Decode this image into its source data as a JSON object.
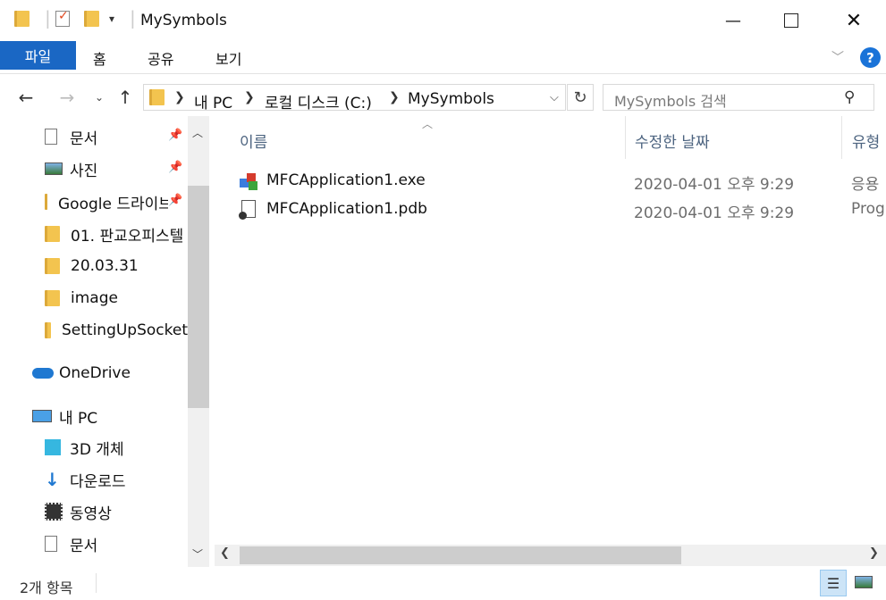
{
  "window": {
    "title": "MySymbols"
  },
  "ribbon": {
    "tabs": [
      "파일",
      "홈",
      "공유",
      "보기"
    ]
  },
  "address": {
    "crumbs": [
      "내 PC",
      "로컬 디스크 (C:)",
      "MySymbols"
    ]
  },
  "search": {
    "placeholder": "MySymbols 검색"
  },
  "sidebar": {
    "quick_access": [
      {
        "label": "문서",
        "icon": "document-icon",
        "pinned": true
      },
      {
        "label": "사진",
        "icon": "pictures-icon",
        "pinned": true
      },
      {
        "label": "Google 드라이브",
        "icon": "folder-icon",
        "pinned": true
      },
      {
        "label": "01. 판교오피스텔",
        "icon": "folder-icon",
        "pinned": false
      },
      {
        "label": "20.03.31",
        "icon": "folder-icon",
        "pinned": false
      },
      {
        "label": "image",
        "icon": "folder-icon",
        "pinned": false
      },
      {
        "label": "SettingUpSocket",
        "icon": "folder-icon",
        "pinned": false
      }
    ],
    "onedrive": {
      "label": "OneDrive"
    },
    "this_pc": {
      "label": "내 PC"
    },
    "pc_items": [
      {
        "label": "3D 개체",
        "icon": "3d-objects-icon"
      },
      {
        "label": "다운로드",
        "icon": "downloads-icon"
      },
      {
        "label": "동영상",
        "icon": "videos-icon"
      },
      {
        "label": "문서",
        "icon": "document-icon"
      }
    ]
  },
  "columns": {
    "name": "이름",
    "date": "수정한 날짜",
    "type": "유형"
  },
  "files": [
    {
      "name": "MFCApplication1.exe",
      "date": "2020-04-01 오후 9:29",
      "type": "응용",
      "icon": "exe-icon"
    },
    {
      "name": "MFCApplication1.pdb",
      "date": "2020-04-01 오후 9:29",
      "type": "Prog",
      "icon": "pdb-file-icon"
    }
  ],
  "status": {
    "count": "2개 항목"
  },
  "colors": {
    "accent": "#1a67c4",
    "help": "#1a73d8"
  }
}
